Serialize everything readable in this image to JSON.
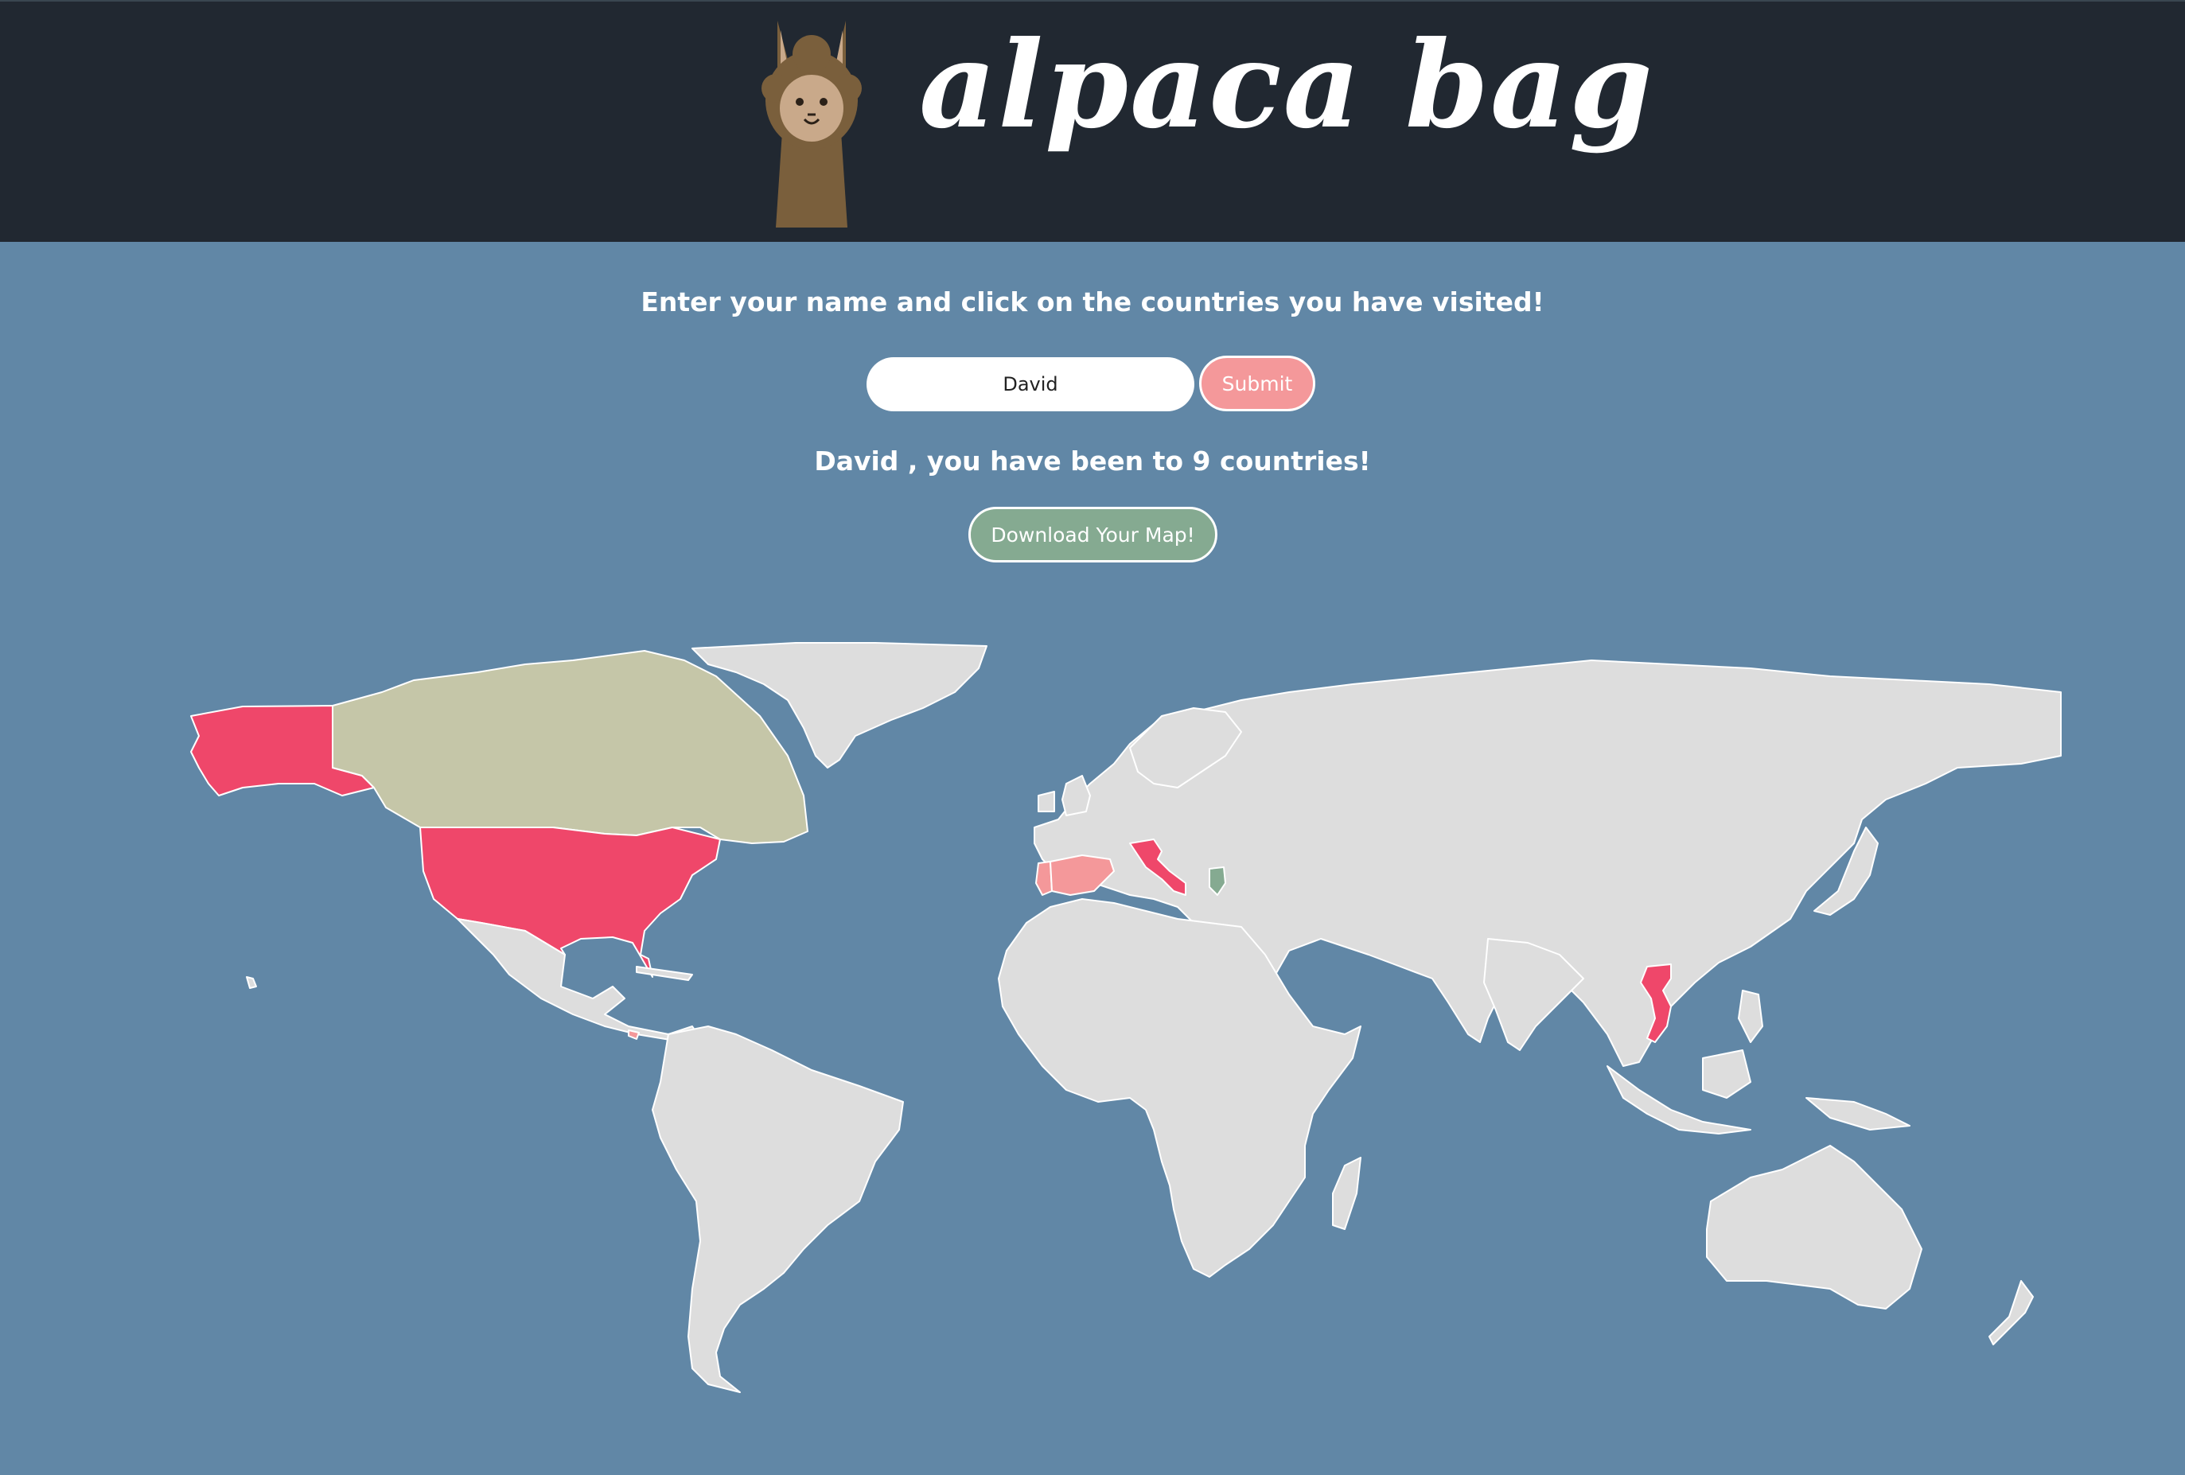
{
  "header": {
    "logo_text": "alpaca bag",
    "logo_icon": "alpaca-icon"
  },
  "form": {
    "instruction": "Enter your name and click on the countries you have visited!",
    "name_value": "David",
    "submit_label": "Submit"
  },
  "result": {
    "name": "David",
    "text_mid": " , you have been to ",
    "count": "9",
    "text_end": " countries!"
  },
  "download": {
    "label": "Download Your Map!"
  },
  "colors": {
    "header_bg": "#212831",
    "ocean": "#6187a6",
    "land_unvisited": "#dddddd",
    "visited_red": "#ef476a",
    "visited_pink": "#f4989a",
    "visited_olive": "#c5c6a8",
    "visited_green": "#85aa91",
    "submit_bg": "#f4989a",
    "download_bg": "#85aa91"
  },
  "map": {
    "countries": [
      {
        "id": "united-states",
        "status": "visited",
        "color": "#ef476a"
      },
      {
        "id": "alaska",
        "status": "visited",
        "color": "#ef476a"
      },
      {
        "id": "canada",
        "status": "visited",
        "color": "#c5c6a8"
      },
      {
        "id": "spain",
        "status": "visited",
        "color": "#f4989a"
      },
      {
        "id": "portugal",
        "status": "visited",
        "color": "#f4989a"
      },
      {
        "id": "italy",
        "status": "visited",
        "color": "#ef476a"
      },
      {
        "id": "greece",
        "status": "visited",
        "color": "#85aa91"
      },
      {
        "id": "vietnam",
        "status": "visited",
        "color": "#ef476a"
      },
      {
        "id": "costa-rica",
        "status": "visited",
        "color": "#f4989a"
      }
    ]
  }
}
